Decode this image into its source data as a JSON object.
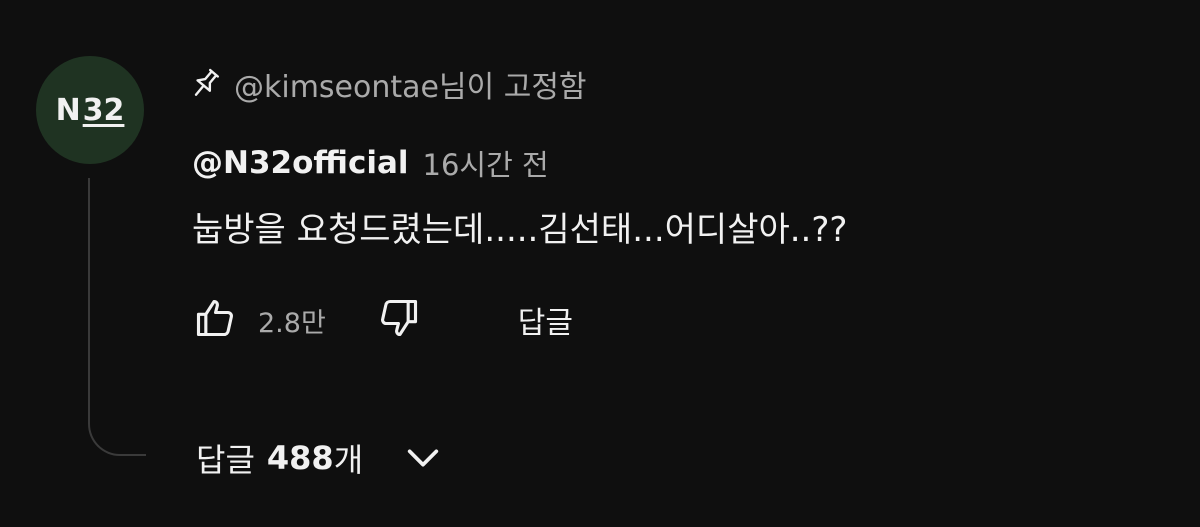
{
  "comment": {
    "avatar": {
      "letter": "N",
      "number": "32"
    },
    "pinned_label": "@kimseontae님이 고정함",
    "author": "@N32official",
    "timestamp": "16시간 전",
    "text": "눕방을 요청드렸는데.....김선태...어디살아..??",
    "likes": "2.8만",
    "reply_label": "답글",
    "replies": {
      "word": "답글",
      "count": "488",
      "unit": "개"
    }
  },
  "colors": {
    "background": "#0f0f0f",
    "primary_text": "#f1f1f1",
    "secondary_text": "#aaaaaa",
    "avatar_bg": "#1f3322"
  },
  "icons": {
    "pin": "pin-icon",
    "like": "thumbs-up-icon",
    "dislike": "thumbs-down-icon",
    "expand": "chevron-down-icon"
  }
}
